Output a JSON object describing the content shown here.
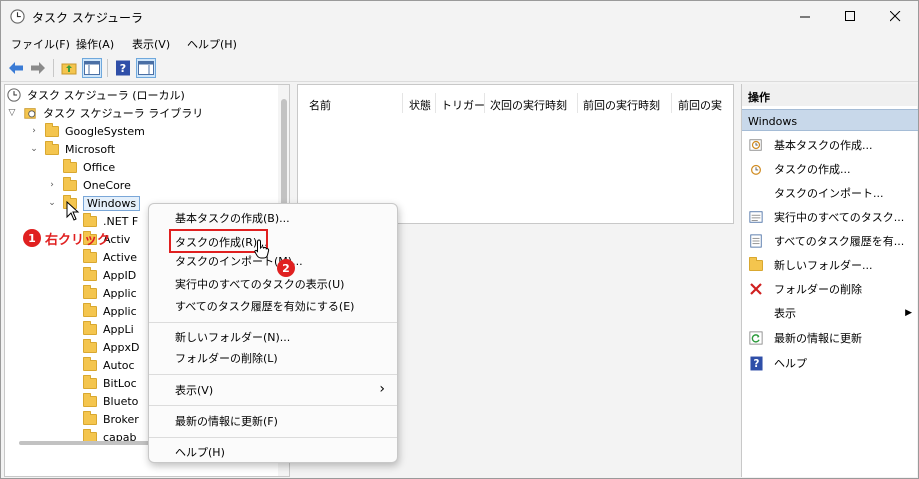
{
  "window": {
    "title": "タスク スケジューラ",
    "controls": {
      "minimize": "—",
      "maximize": "☐",
      "close": "✕"
    }
  },
  "menubar": [
    "ファイル(F)",
    "操作(A)",
    "表示(V)",
    "ヘルプ(H)"
  ],
  "toolbar": [
    "back-arrow-icon",
    "forward-arrow-icon",
    "folder-up-icon",
    "show-hide-tree-icon",
    "help-icon",
    "show-action-pane-icon"
  ],
  "tree": {
    "root": "タスク スケジューラ (ローカル)",
    "library": "タスク スケジューラ ライブラリ",
    "google": "GoogleSystem",
    "microsoft": "Microsoft",
    "office": "Office",
    "onecore": "OneCore",
    "windows": "Windows",
    "children": [
      ".NET F",
      "Activ",
      "Active",
      "AppID",
      "Applic",
      "Applic",
      "AppLi",
      "AppxD",
      "Autoc",
      "BitLoc",
      "Blueto",
      "Broker",
      "capab"
    ]
  },
  "columns": [
    "名前",
    "状態",
    "トリガー",
    "次回の実行時刻",
    "前回の実行時刻",
    "前回の実"
  ],
  "ops": {
    "header": "操作",
    "section": "Windows",
    "items": [
      {
        "label": "基本タスクの作成...",
        "icon": "clock-task-icon"
      },
      {
        "label": "タスクの作成...",
        "icon": "task-create-icon"
      },
      {
        "label": "タスクのインポート...",
        "icon": "none"
      },
      {
        "label": "実行中のすべてのタスク...",
        "icon": "running-tasks-icon"
      },
      {
        "label": "すべてのタスク履歴を有...",
        "icon": "history-icon"
      },
      {
        "label": "新しいフォルダー...",
        "icon": "new-folder-icon"
      },
      {
        "label": "フォルダーの削除",
        "icon": "delete-x-icon"
      },
      {
        "label": "表示",
        "icon": "none"
      },
      {
        "label": "最新の情報に更新",
        "icon": "refresh-icon"
      },
      {
        "label": "ヘルプ",
        "icon": "help-icon"
      }
    ],
    "submenu_arrow": "▶"
  },
  "context_menu": {
    "items": [
      "基本タスクの作成(B)...",
      "タスクの作成(R)...",
      "タスクのインポート(M)...",
      "実行中のすべてのタスクの表示(U)",
      "すべてのタスク履歴を有効にする(E)",
      "新しいフォルダー(N)...",
      "フォルダーの削除(L)",
      "表示(V)",
      "最新の情報に更新(F)",
      "ヘルプ(H)"
    ],
    "submenu_arrow": "›"
  },
  "annotations": {
    "step1_number": "1",
    "step1_label": "右クリック",
    "step2_number": "2"
  },
  "colors": {
    "annotation_red": "#e02020",
    "section_blue": "#c8d8ea",
    "folder_yellow": "#f4c54e"
  }
}
